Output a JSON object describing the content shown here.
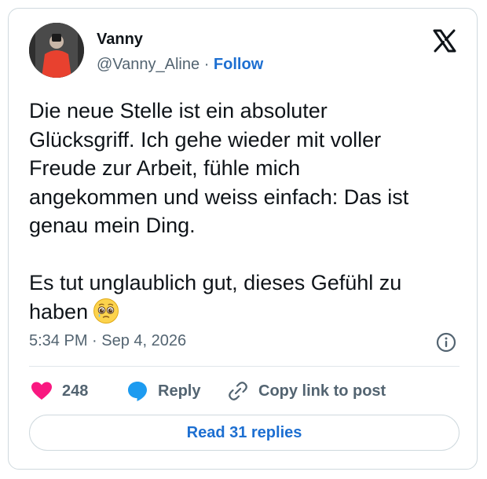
{
  "author": {
    "name": "Vanny",
    "handle": "@Vanny_Aline",
    "separator": "·",
    "follow_label": "Follow"
  },
  "tweet": {
    "text": "Die neue Stelle ist ein absoluter\nGlücksgriff. Ich gehe wieder mit voller\nFreude zur Arbeit, fühle mich\nangekommen und weiss einfach: Das ist\ngenau mein Ding.\n\nEs tut unglaublich gut, dieses Gefühl zu\nhaben",
    "emoji": "pleading-face-with-tears",
    "timestamp": "5:34 PM · Sep 4, 2026"
  },
  "actions": {
    "like_count": "248",
    "reply_label": "Reply",
    "copy_link_label": "Copy link to post"
  },
  "read_replies_label": "Read 31 replies",
  "colors": {
    "like": "#f91880",
    "reply": "#1d9bf0",
    "link": "#1d6fd1",
    "muted": "#536471",
    "border": "#cfd9de"
  },
  "icons": [
    "x-logo-icon",
    "info-icon",
    "heart-icon",
    "reply-bubble-icon",
    "link-icon"
  ]
}
